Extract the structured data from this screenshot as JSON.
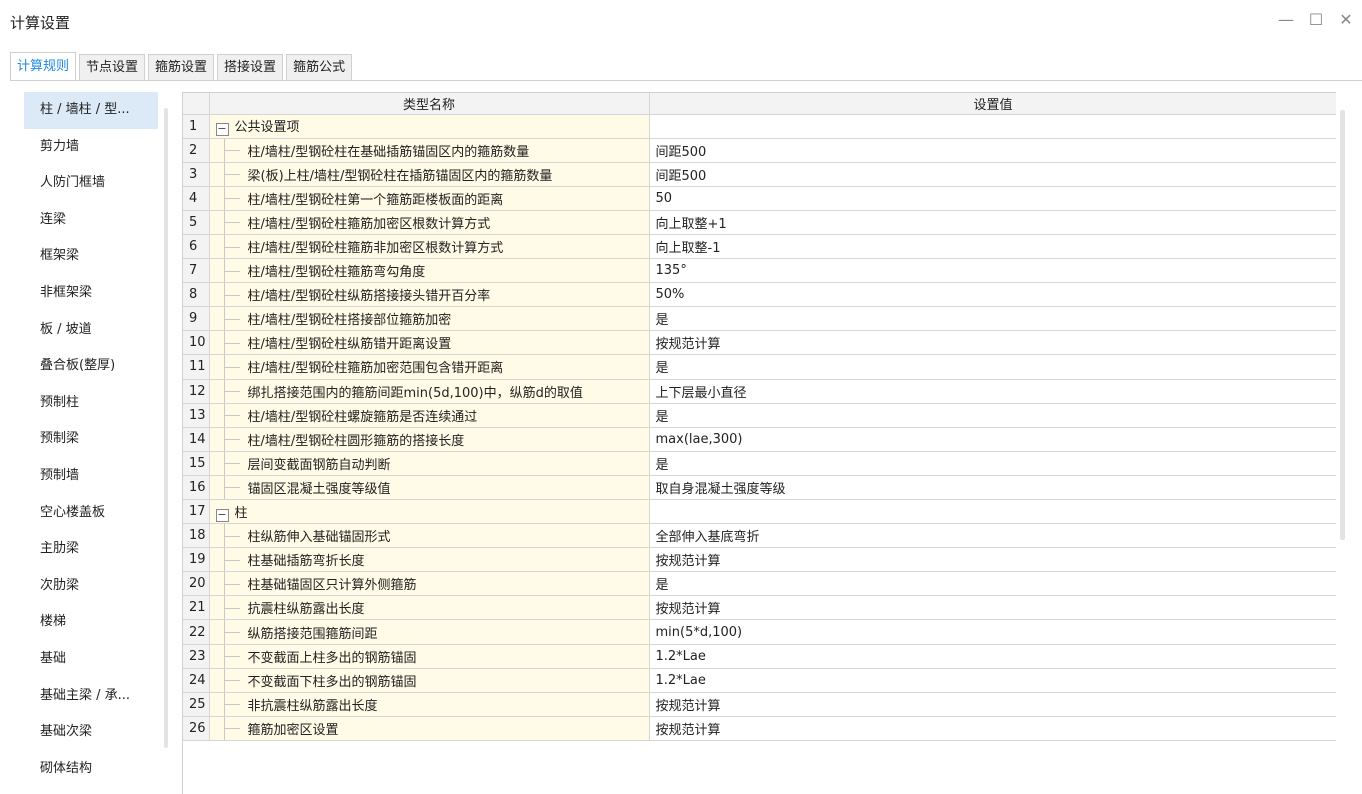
{
  "window": {
    "title": "计算设置",
    "minimize": "—",
    "maximize": "☐",
    "close": "✕"
  },
  "tabs": [
    {
      "label": "计算规则",
      "active": true
    },
    {
      "label": "节点设置"
    },
    {
      "label": "箍筋设置"
    },
    {
      "label": "搭接设置"
    },
    {
      "label": "箍筋公式"
    }
  ],
  "sidebar": {
    "items": [
      {
        "label": "柱 / 墙柱 / 型...",
        "active": true
      },
      {
        "label": "剪力墙"
      },
      {
        "label": "人防门框墙"
      },
      {
        "label": "连梁"
      },
      {
        "label": "框架梁"
      },
      {
        "label": "非框架梁"
      },
      {
        "label": "板 / 坡道"
      },
      {
        "label": "叠合板(整厚)"
      },
      {
        "label": "预制柱"
      },
      {
        "label": "预制梁"
      },
      {
        "label": "预制墙"
      },
      {
        "label": "空心楼盖板"
      },
      {
        "label": "主肋梁"
      },
      {
        "label": "次肋梁"
      },
      {
        "label": "楼梯"
      },
      {
        "label": "基础"
      },
      {
        "label": "基础主梁 / 承..."
      },
      {
        "label": "基础次梁"
      },
      {
        "label": "砌体结构"
      }
    ]
  },
  "grid": {
    "columns": {
      "name": "类型名称",
      "value": "设置值"
    },
    "rows": [
      {
        "n": "1",
        "name": "公共设置项",
        "value": "",
        "group": true,
        "toggle": "−"
      },
      {
        "n": "2",
        "name": "柱/墙柱/型钢砼柱在基础插筋锚固区内的箍筋数量",
        "value": "间距500"
      },
      {
        "n": "3",
        "name": "梁(板)上柱/墙柱/型钢砼柱在插筋锚固区内的箍筋数量",
        "value": "间距500"
      },
      {
        "n": "4",
        "name": "柱/墙柱/型钢砼柱第一个箍筋距楼板面的距离",
        "value": "50"
      },
      {
        "n": "5",
        "name": "柱/墙柱/型钢砼柱箍筋加密区根数计算方式",
        "value": "向上取整+1"
      },
      {
        "n": "6",
        "name": "柱/墙柱/型钢砼柱箍筋非加密区根数计算方式",
        "value": "向上取整-1"
      },
      {
        "n": "7",
        "name": "柱/墙柱/型钢砼柱箍筋弯勾角度",
        "value": "135°"
      },
      {
        "n": "8",
        "name": "柱/墙柱/型钢砼柱纵筋搭接接头错开百分率",
        "value": "50%"
      },
      {
        "n": "9",
        "name": "柱/墙柱/型钢砼柱搭接部位箍筋加密",
        "value": "是"
      },
      {
        "n": "10",
        "name": "柱/墙柱/型钢砼柱纵筋错开距离设置",
        "value": "按规范计算"
      },
      {
        "n": "11",
        "name": "柱/墙柱/型钢砼柱箍筋加密范围包含错开距离",
        "value": "是"
      },
      {
        "n": "12",
        "name": "绑扎搭接范围内的箍筋间距min(5d,100)中，纵筋d的取值",
        "value": "上下层最小直径"
      },
      {
        "n": "13",
        "name": "柱/墙柱/型钢砼柱螺旋箍筋是否连续通过",
        "value": "是"
      },
      {
        "n": "14",
        "name": "柱/墙柱/型钢砼柱圆形箍筋的搭接长度",
        "value": "max(lae,300)"
      },
      {
        "n": "15",
        "name": "层间变截面钢筋自动判断",
        "value": "是"
      },
      {
        "n": "16",
        "name": "锚固区混凝土强度等级值",
        "value": "取自身混凝土强度等级"
      },
      {
        "n": "17",
        "name": "柱",
        "value": "",
        "group": true,
        "toggle": "−"
      },
      {
        "n": "18",
        "name": "柱纵筋伸入基础锚固形式",
        "value": "全部伸入基底弯折"
      },
      {
        "n": "19",
        "name": "柱基础插筋弯折长度",
        "value": "按规范计算"
      },
      {
        "n": "20",
        "name": "柱基础锚固区只计算外侧箍筋",
        "value": "是"
      },
      {
        "n": "21",
        "name": "抗震柱纵筋露出长度",
        "value": "按规范计算"
      },
      {
        "n": "22",
        "name": "纵筋搭接范围箍筋间距",
        "value": "min(5*d,100)"
      },
      {
        "n": "23",
        "name": "不变截面上柱多出的钢筋锚固",
        "value": "1.2*Lae"
      },
      {
        "n": "24",
        "name": "不变截面下柱多出的钢筋锚固",
        "value": "1.2*Lae"
      },
      {
        "n": "25",
        "name": "非抗震柱纵筋露出长度",
        "value": "按规范计算"
      },
      {
        "n": "26",
        "name": "箍筋加密区设置",
        "value": "按规范计算"
      }
    ]
  }
}
